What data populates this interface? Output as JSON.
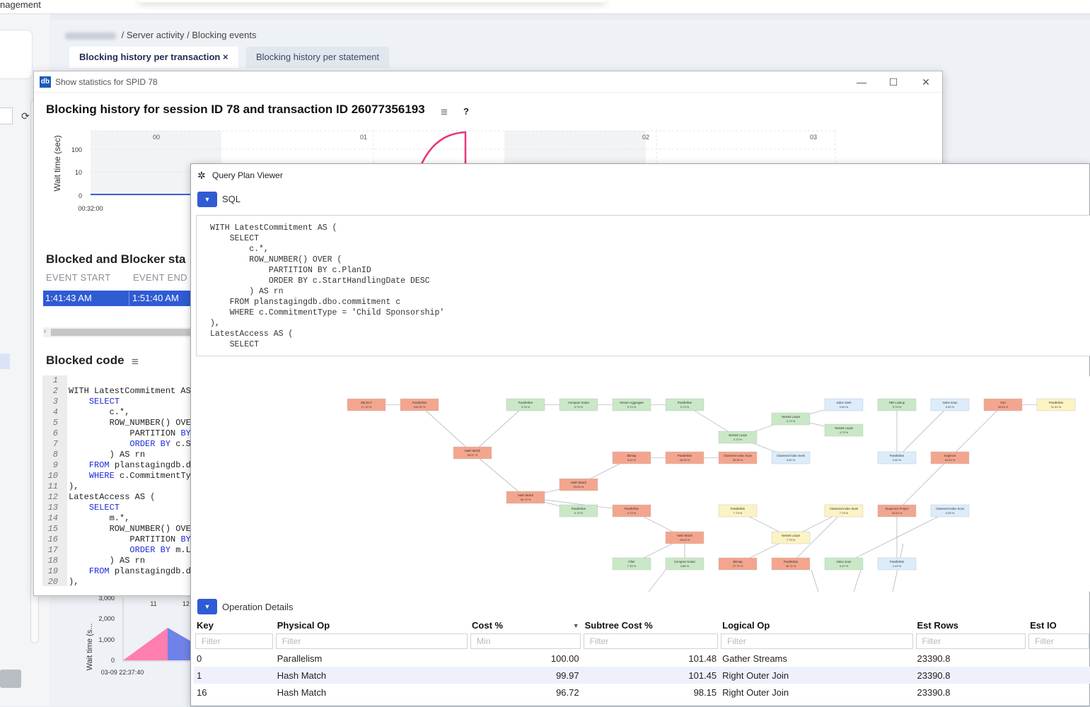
{
  "app": {
    "title": "nagement"
  },
  "breadcrumb": {
    "sep1": "/",
    "item1": "Server activity",
    "sep2": "/",
    "item2": "Blocking events"
  },
  "tabs": {
    "tab1_label": "Blocking history per transaction",
    "tab1_close": "×",
    "tab2_label": "Blocking history per statement"
  },
  "spid": {
    "window_title": "Show statistics for SPID 78",
    "logo": "db",
    "heading": "Blocking history for session ID 78 and transaction ID 26077356193",
    "help": "?",
    "wait_chart": {
      "ylabel": "Wait time (sec)",
      "yticks": [
        "100",
        "10",
        "0"
      ],
      "xstart": "00:32:00",
      "top_ticks": [
        "00",
        "01",
        "02",
        "03"
      ]
    },
    "blocked_stats_heading": "Blocked and Blocker sta",
    "col_event_start": "EVENT START",
    "col_event_end": "EVENT END",
    "event_start": "1:41:43 AM",
    "event_end": "1:51:40 AM",
    "blocked_code_heading": "Blocked code",
    "code_lines": [
      {
        "n": "1",
        "parts": [
          {
            "t": ""
          }
        ]
      },
      {
        "n": "2",
        "parts": [
          {
            "t": "WITH LatestCommitment AS"
          }
        ]
      },
      {
        "n": "3",
        "parts": [
          {
            "t": "    "
          },
          {
            "t": "SELECT",
            "k": 1
          }
        ]
      },
      {
        "n": "4",
        "parts": [
          {
            "t": "        c.*,"
          }
        ]
      },
      {
        "n": "5",
        "parts": [
          {
            "t": "        ROW_NUMBER() OVE"
          }
        ]
      },
      {
        "n": "6",
        "parts": [
          {
            "t": "            PARTITION "
          },
          {
            "t": "BY",
            "k": 1
          }
        ]
      },
      {
        "n": "7",
        "parts": [
          {
            "t": "            "
          },
          {
            "t": "ORDER BY",
            "k": 1
          },
          {
            "t": " c.S"
          }
        ]
      },
      {
        "n": "8",
        "parts": [
          {
            "t": "        ) AS rn"
          }
        ]
      },
      {
        "n": "9",
        "parts": [
          {
            "t": "    "
          },
          {
            "t": "FROM",
            "k": 1
          },
          {
            "t": " planstagingdb.d"
          }
        ]
      },
      {
        "n": "10",
        "parts": [
          {
            "t": "    "
          },
          {
            "t": "WHERE",
            "k": 1
          },
          {
            "t": " c.CommitmentTy"
          }
        ]
      },
      {
        "n": "11",
        "parts": [
          {
            "t": "),"
          }
        ]
      },
      {
        "n": "12",
        "parts": [
          {
            "t": "LatestAccess AS ("
          }
        ]
      },
      {
        "n": "13",
        "parts": [
          {
            "t": "    "
          },
          {
            "t": "SELECT",
            "k": 1
          }
        ]
      },
      {
        "n": "14",
        "parts": [
          {
            "t": "        m.*,"
          }
        ]
      },
      {
        "n": "15",
        "parts": [
          {
            "t": "        ROW_NUMBER() OVE"
          }
        ]
      },
      {
        "n": "16",
        "parts": [
          {
            "t": "            PARTITION "
          },
          {
            "t": "BY",
            "k": 1
          }
        ]
      },
      {
        "n": "17",
        "parts": [
          {
            "t": "            "
          },
          {
            "t": "ORDER BY",
            "k": 1
          },
          {
            "t": " m.L"
          }
        ]
      },
      {
        "n": "18",
        "parts": [
          {
            "t": "        ) AS rn"
          }
        ]
      },
      {
        "n": "19",
        "parts": [
          {
            "t": "    "
          },
          {
            "t": "FROM",
            "k": 1
          },
          {
            "t": " planstagingdb.d"
          }
        ]
      },
      {
        "n": "20",
        "parts": [
          {
            "t": "),"
          }
        ]
      }
    ]
  },
  "bg_chart": {
    "ylabel": "Wait time (s...",
    "yticks": [
      "3,000",
      "2,000",
      "1,000",
      "0"
    ],
    "xticks": [
      "11",
      "12"
    ],
    "xstart": "03-09 22:37:40"
  },
  "qpv": {
    "title": "Query Plan Viewer",
    "sql_label": "SQL",
    "sql_text": "WITH LatestCommitment AS (\n    SELECT\n        c.*,\n        ROW_NUMBER() OVER (\n            PARTITION BY c.PlanID\n            ORDER BY c.StartHandlingDate DESC\n        ) AS rn\n    FROM planstagingdb.dbo.commitment c\n    WHERE c.CommitmentType = 'Child Sponsorship'\n),\nLatestAccess AS (\n    SELECT",
    "opdet_label": "Operation Details",
    "plan_colors": {
      "red": "#f4a58e",
      "green": "#c9e8c6",
      "blue": "#dcecfb",
      "yellow": "#fbf3c2"
    },
    "plan_nodes": [
      {
        "c": "red",
        "name": "SELECT",
        "cost": "17.10 %"
      },
      {
        "c": "red",
        "name": "Parallelism",
        "cost": "100.00 %"
      },
      {
        "c": "red",
        "name": "Hash Match",
        "cost": "99.97 %"
      },
      {
        "c": "red",
        "name": "Hash Match",
        "cost": "96.72 %"
      },
      {
        "c": "red",
        "name": "Hash Match",
        "cost": "93.63 %"
      },
      {
        "c": "green",
        "name": "Parallelism",
        "cost": "3.76 %"
      },
      {
        "c": "green",
        "name": "Compute Scalar",
        "cost": "3.73 %"
      },
      {
        "c": "green",
        "name": "Stream Aggregate",
        "cost": "3.73 %"
      },
      {
        "c": "green",
        "name": "Parallelism",
        "cost": "3.73 %"
      },
      {
        "c": "green",
        "name": "Nested Loops",
        "cost": "3.73 %"
      },
      {
        "c": "green",
        "name": "Nested Loops",
        "cost": "3.73 %"
      },
      {
        "c": "blue",
        "name": "Index Seek",
        "cost": "0.00 %"
      },
      {
        "c": "green",
        "name": "RID Lookup",
        "cost": "3.73 %"
      },
      {
        "c": "green",
        "name": "Nested Loops",
        "cost": "3.73 %"
      },
      {
        "c": "blue",
        "name": "Index Scan",
        "cost": "0.00 %"
      },
      {
        "c": "red",
        "name": "Sort",
        "cost": "43.63 %"
      },
      {
        "c": "yellow",
        "name": "Parallelism",
        "cost": "11.31 %"
      },
      {
        "c": "red",
        "name": "Bitmap",
        "cost": "6.00 %"
      },
      {
        "c": "red",
        "name": "Parallelism",
        "cost": "28.95 %"
      },
      {
        "c": "red",
        "name": "Clustered Index Scan",
        "cost": "28.95 %"
      },
      {
        "c": "blue",
        "name": "Clustered Index Seek",
        "cost": "0.00 %"
      },
      {
        "c": "blue",
        "name": "Parallelism",
        "cost": "0.00 %"
      },
      {
        "c": "red",
        "name": "Segment",
        "cost": "43.63 %"
      },
      {
        "c": "green",
        "name": "Parallelism",
        "cost": "3.73 %"
      },
      {
        "c": "red",
        "name": "Parallelism",
        "cost": "4.73 %"
      },
      {
        "c": "yellow",
        "name": "Parallelism",
        "cost": "7.73 %"
      },
      {
        "c": "yellow",
        "name": "Clustered Index Seek",
        "cost": "7.73 %"
      },
      {
        "c": "red",
        "name": "Sequence Project",
        "cost": "43.63 %"
      },
      {
        "c": "blue",
        "name": "Clustered Index Scan",
        "cost": "0.00 %"
      },
      {
        "c": "red",
        "name": "Hash Match",
        "cost": "43.63 %"
      },
      {
        "c": "yellow",
        "name": "Nested Loops",
        "cost": "7.73 %"
      },
      {
        "c": "green",
        "name": "Filter",
        "cost": "7.33 %"
      },
      {
        "c": "green",
        "name": "Compute Scalar",
        "cost": "3.85 %"
      },
      {
        "c": "red",
        "name": "Bitmap",
        "cost": "27.71 %"
      },
      {
        "c": "red",
        "name": "Parallelism",
        "cost": "28.71 %"
      },
      {
        "c": "green",
        "name": "Index Scan",
        "cost": "3.47 %"
      },
      {
        "c": "blue",
        "name": "Parallelism",
        "cost": "1.03 %"
      }
    ],
    "table": {
      "headers": [
        "Key",
        "Physical Op",
        "Cost %",
        "Subtree Cost %",
        "Logical Op",
        "Est Rows",
        "Est IO"
      ],
      "sort_icon": "▼",
      "filters": [
        "Filter",
        "Filter",
        "Min",
        "Filter",
        "Filter",
        "Filter",
        "Filter"
      ],
      "rows": [
        {
          "key": "0",
          "physical": "Parallelism",
          "cost": "100.00",
          "subtree": "101.48",
          "logical": "Gather Streams",
          "rows": "23390.8",
          "io": ""
        },
        {
          "key": "1",
          "physical": "Hash Match",
          "cost": "99.97",
          "subtree": "101.45",
          "logical": "Right Outer Join",
          "rows": "23390.8",
          "io": ""
        },
        {
          "key": "16",
          "physical": "Hash Match",
          "cost": "96.72",
          "subtree": "98.15",
          "logical": "Right Outer Join",
          "rows": "23390.8",
          "io": ""
        }
      ]
    }
  }
}
